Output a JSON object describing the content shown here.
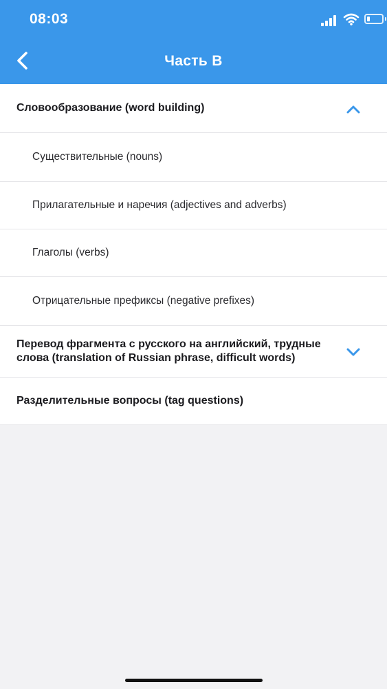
{
  "status_bar": {
    "time": "08:03",
    "signal_icon": "cellular-signal-icon",
    "wifi_icon": "wifi-icon",
    "battery_icon": "battery-icon",
    "battery_level": 0.2
  },
  "header": {
    "title": "Часть B",
    "back_icon": "chevron-left-icon",
    "background_color": "#3a97ea"
  },
  "sections": [
    {
      "label": "Словообразование (word building)",
      "expanded": true,
      "chevron_icon": "chevron-up-icon",
      "items": [
        {
          "label": "Существительные (nouns)"
        },
        {
          "label": "Прилагательные и наречия (adjectives and adverbs)"
        },
        {
          "label": "Глаголы (verbs)"
        },
        {
          "label": "Отрицательные префиксы (negative prefixes)"
        }
      ]
    },
    {
      "label": "Перевод фрагмента с русского на английский, трудные слова (translation of Russian phrase, difficult words)",
      "expanded": false,
      "chevron_icon": "chevron-down-icon",
      "items": []
    },
    {
      "label": "Разделительные вопросы (tag questions)",
      "expanded": false,
      "items": []
    }
  ],
  "accent_color": "#3a97ea"
}
